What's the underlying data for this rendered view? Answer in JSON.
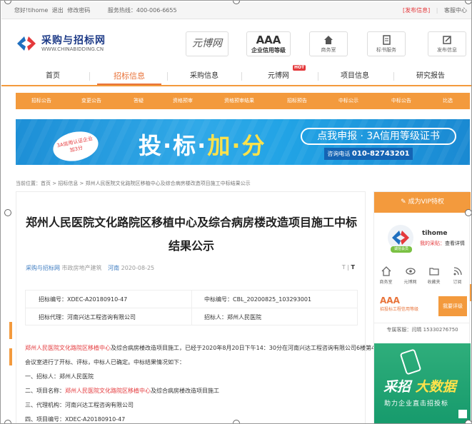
{
  "topbar": {
    "greeting": "您好!tihome",
    "logout": "退出",
    "change_pwd": "修改密码",
    "hotline": "服务热线：400-006-6655",
    "publish": "[发布信息]",
    "service": "客服中心"
  },
  "logo": {
    "name": "采购与招标网",
    "domain": "WWW.CHINABIDDING.CN"
  },
  "header": {
    "yuanbo": "元博网",
    "aaa_title": "AAA",
    "aaa_sub": "企业信用等级",
    "buttons": [
      {
        "label": "商务室",
        "icon": "home-icon"
      },
      {
        "label": "标书服务",
        "icon": "document-icon"
      },
      {
        "label": "发布信息",
        "icon": "edit-icon"
      }
    ]
  },
  "nav": {
    "items": [
      "首页",
      "招标信息",
      "采购信息",
      "元博网",
      "项目信息",
      "研究报告"
    ],
    "active_index": 1,
    "hot_badge": "HOT"
  },
  "subnav": {
    "items": [
      "招标公告",
      "变更公告",
      "答疑",
      "资格预审",
      "资格预审结果",
      "招标预告",
      "中标公示",
      "中标公告",
      "比选"
    ]
  },
  "banner": {
    "stamp_line1": "3A信用认证企业",
    "stamp_line2": "加3分",
    "slogan_1": "投·标·",
    "slogan_2": "加·分",
    "pill": "点我申报 · 3A信用等级证书",
    "tel_label": "咨询电话",
    "tel": "010-82743201"
  },
  "breadcrumb": "当前位置：首页 > 招标信息 > 郑州人民医院文化路院区移植中心及综合病房楼改造项目施工中标结果公示",
  "article": {
    "title_line1": "郑州人民医院文化路院区移植中心及综合病房楼改造项目施工中标",
    "title_line2": "结果公示",
    "meta_source": "采购与招标网",
    "meta_category": "市政房地产建筑",
    "meta_region": "河南",
    "meta_date": "2020-08-25",
    "font_toggle_small": "T",
    "font_toggle_large": "T",
    "info": {
      "bid_no": "招标编号：XDEC-A20180910-47",
      "win_no": "中标编号：CBL_20200825_103293001",
      "agent": "招标代理：河南兴达工程咨询有限公司",
      "tenderer": "招标人：郑州人民医院"
    },
    "body": {
      "p1_highlight": "郑州人民医院文化路院区移植中心",
      "p1_rest": "及综合病房楼改造项目施工，已经于2020年8月20日下午14：30分在河南兴达工程咨询有限公司6楼第4",
      "p2": "会议室进行了开标、评标，中标人已确定。中标结果情况如下：",
      "p3": "一、招标人：郑州人民医院",
      "p4_prefix": "二、项目名称：",
      "p4_highlight": "郑州人民医院文化路院区移植中心",
      "p4_rest": "及综合病房楼改造项目施工",
      "p5": "三、代理机构：河南兴达工程咨询有限公司",
      "p6": "四、项目编号：XDEC-A20180910-47"
    }
  },
  "sidebar": {
    "vip": "成为VIP特权",
    "badge": "诚信会员",
    "user": "tihome",
    "my_collect": "我的采贴：",
    "view_detail": "查看详情",
    "icons": [
      {
        "label": "商务室",
        "icon": "home-icon"
      },
      {
        "label": "元博网",
        "icon": "eye-icon"
      },
      {
        "label": "收藏夹",
        "icon": "folder-icon"
      },
      {
        "label": "订阅",
        "icon": "rss-icon"
      }
    ],
    "aaa_title": "AAA",
    "aaa_sub": "招投标工程信用等级",
    "eval_btn": "我要评级",
    "phone": "专属客服：闫晴 15330276750",
    "ad_title_1": "采招",
    "ad_title_2": "大数据",
    "ad_sub": "助力企业直击招投标"
  },
  "colors": {
    "accent": "#f39a3d",
    "active_nav": "#e8733a",
    "highlight_red": "#e4393c",
    "banner_blue": "#1d8fd6",
    "ad_green": "#169a6c"
  }
}
